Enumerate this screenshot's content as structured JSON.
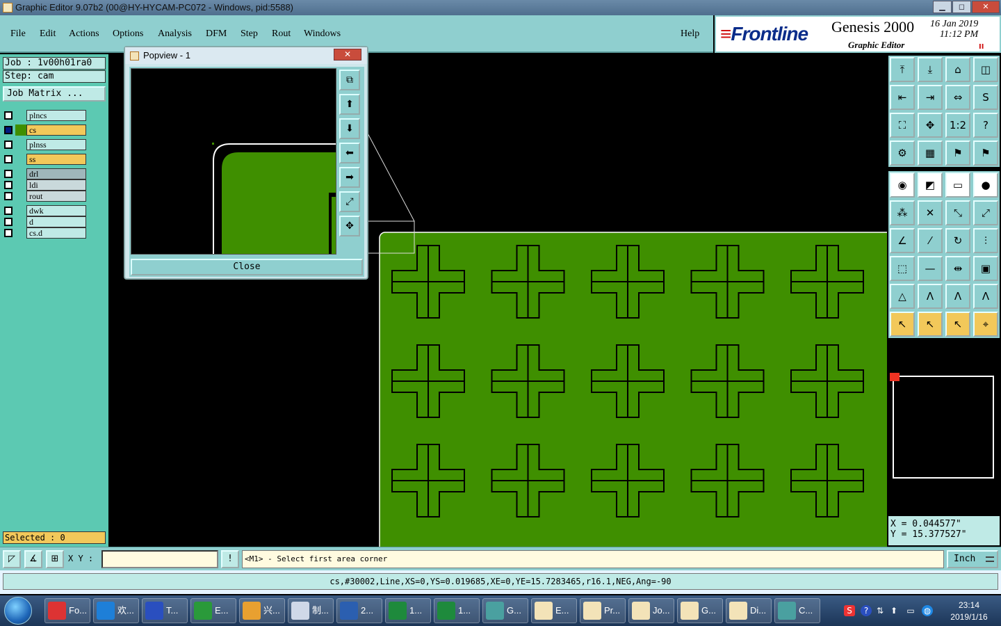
{
  "window": {
    "title": "Graphic Editor 9.07b2 (00@HY-HYCAM-PC072 - Windows, pid:5588)",
    "min": "▁",
    "max": "◻",
    "close": "✕"
  },
  "menu": {
    "items": [
      "File",
      "Edit",
      "Actions",
      "Options",
      "Analysis",
      "DFM",
      "Step",
      "Rout",
      "Windows"
    ],
    "help": "Help"
  },
  "brand": {
    "logo_bars": "≡",
    "logo": "Frontline",
    "product": "Genesis 2000",
    "subtitle": "Graphic Editor",
    "date": "16 Jan 2019",
    "time": "11:12 PM",
    "pause": "II"
  },
  "left": {
    "job": "Job : 1v00h01ra0",
    "step": "Step: cam",
    "job_matrix": "Job Matrix ...",
    "layers": [
      {
        "name": "plncs",
        "color": "#bfeae6"
      },
      {
        "name": "cs",
        "color": "#f2c85a"
      },
      {
        "name": "plnss",
        "color": "#bfeae6"
      },
      {
        "name": "ss",
        "color": "#f2c85a"
      },
      {
        "name": "drl",
        "color": "#9fb7bb"
      },
      {
        "name": "ldi",
        "color": "#c9d9db"
      },
      {
        "name": "rout",
        "color": "#c9d9db"
      },
      {
        "name": "dwk",
        "color": "#bfeae6"
      },
      {
        "name": "d",
        "color": "#bfeae6"
      },
      {
        "name": "cs.d",
        "color": "#bfeae6"
      }
    ],
    "selected": "Selected : 0"
  },
  "popview": {
    "title": "Popview - 1",
    "close_x": "✕",
    "close_label": "Close",
    "tools": [
      "⧉",
      "⬆",
      "⬇",
      "⬅",
      "➡",
      "⤢",
      "✥"
    ]
  },
  "canvas": {
    "board_color": "#3f8f00",
    "pattern_rows": 3,
    "pattern_cols": 5
  },
  "tools": {
    "group1": [
      "⤒",
      "⤓",
      "⌂",
      "◫",
      "⇤",
      "⇥",
      "⇔",
      "S",
      "⛶",
      "✥",
      "1:2",
      "?",
      "⚙",
      "▦",
      "⚑",
      "⚑"
    ],
    "group2": [
      "◉",
      "◩",
      "▭",
      "●",
      "⁂",
      "✕",
      "⤡",
      "⤢",
      "∠",
      "⁄",
      "↻",
      "⫶",
      "⬚",
      "—",
      "⇹",
      "▣",
      "△",
      "Λ",
      "Λ",
      "Λ",
      "↖",
      "↖",
      "↖",
      "⌖"
    ]
  },
  "coords": {
    "x": "X = 0.044577\"",
    "y": "Y = 15.377527\""
  },
  "command": {
    "xy_label": "X Y :",
    "xy_value": "",
    "alert": "!",
    "prompt": "<M1> - Select first area corner",
    "units": "Inch"
  },
  "info": {
    "text": "cs,#30002,Line,XS=0,YS=0.019685,XE=0,YE=15.7283465,r16.1,NEG,Ang=-90"
  },
  "taskbar": {
    "tasks": [
      "Fo...",
      "欢...",
      "T...",
      "E...",
      "兴...",
      "制...",
      "2...",
      "1...",
      "1...",
      "G...",
      "E...",
      "Pr...",
      "Jo...",
      "G...",
      "Di...",
      "C..."
    ],
    "time": "23:14",
    "date": "2019/1/16"
  }
}
